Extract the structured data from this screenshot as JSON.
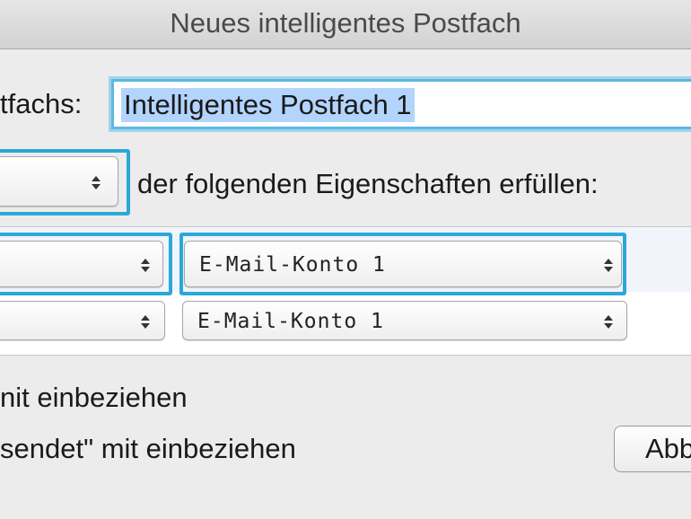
{
  "window": {
    "title": "Neues intelligentes Postfach"
  },
  "form": {
    "name_label": "tfachs:",
    "name_value": "Intelligentes Postfach 1",
    "condition_suffix": "der folgenden Eigenschaften erfüllen:"
  },
  "rules": [
    {
      "value": "E-Mail-Konto 1",
      "focused": true
    },
    {
      "value": "E-Mail-Konto 1",
      "focused": false
    }
  ],
  "options": {
    "include_trash": "nit einbeziehen",
    "include_sent": "sendet\" mit einbeziehen"
  },
  "buttons": {
    "cancel_label": "Abb"
  },
  "colors": {
    "focus_ring": "#2aa8d8",
    "selection": "#b3d4fc"
  }
}
